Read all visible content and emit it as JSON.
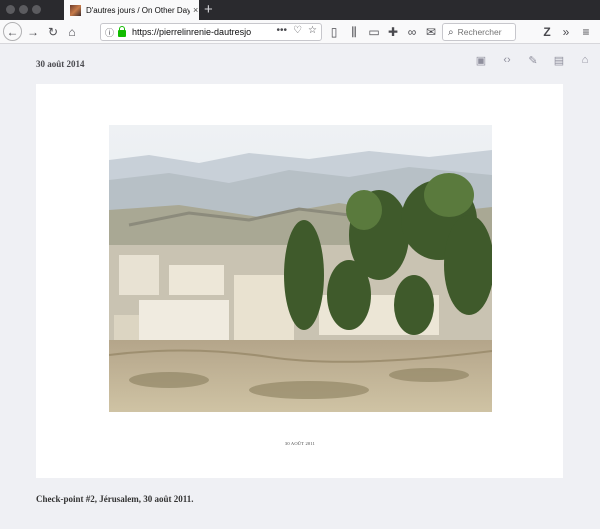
{
  "browser": {
    "tab_title": "D'autres jours / On Other Days",
    "tab_close": "×",
    "new_tab": "+",
    "url_host": "https://pierrelinrenie-dautresjo",
    "search_placeholder": "Rechercher"
  },
  "post": {
    "date": "30 août 2014",
    "photo_caption": "30 AOÛT 2011",
    "text": "Check-point #2, Jérusalem, 30 août 2011."
  },
  "colors": {
    "titlebar": "#2a2a2e",
    "toolbar": "#f9f9fa",
    "page_bg": "#eff0f4",
    "lock_green": "#12bc00"
  }
}
